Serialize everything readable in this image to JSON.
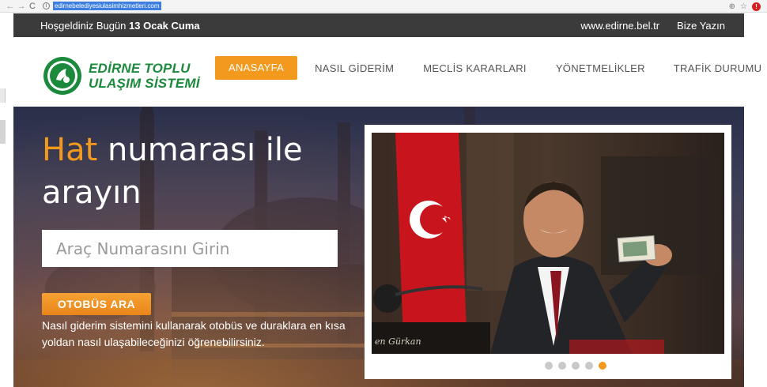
{
  "browser": {
    "url": "edirnebelediyesiulasimhizmetleri.com",
    "back_icon": "arrow-left-icon",
    "forward_icon": "arrow-right-icon",
    "reload_icon": "reload-icon"
  },
  "topbar": {
    "welcome_prefix": "Hoşgeldiniz Bugün ",
    "date": "13 Ocak Cuma",
    "site_link": "www.edirne.bel.tr",
    "contact_link": "Bize Yazın"
  },
  "logo": {
    "line1": "EDİRNE TOPLU",
    "line2": "ULAŞIM SİSTEMİ"
  },
  "nav": [
    {
      "label": "ANASAYFA",
      "active": true
    },
    {
      "label": "NASIL GİDERİM",
      "active": false
    },
    {
      "label": "MECLİS KARARLARI",
      "active": false
    },
    {
      "label": "YÖNETMELİKLER",
      "active": false
    },
    {
      "label": "TRAFİK DURUMU",
      "active": false
    }
  ],
  "hero": {
    "title_accent": "Hat",
    "title_rest": " numarası ile arayın",
    "search_placeholder": "Araç Numarasını Girin",
    "button_label": "OTOBÜS ARA",
    "description": "Nasıl giderim sistemini kullanarak otobüs ve duraklara en kısa yoldan nasıl ulaşabileceğinizi öğrenebilirsiniz."
  },
  "slider": {
    "slide_count": 5,
    "active_index": 4
  },
  "colors": {
    "accent": "#f39a1e",
    "brand_green": "#1c8a3c",
    "topbar_bg": "#3b3b3b"
  }
}
